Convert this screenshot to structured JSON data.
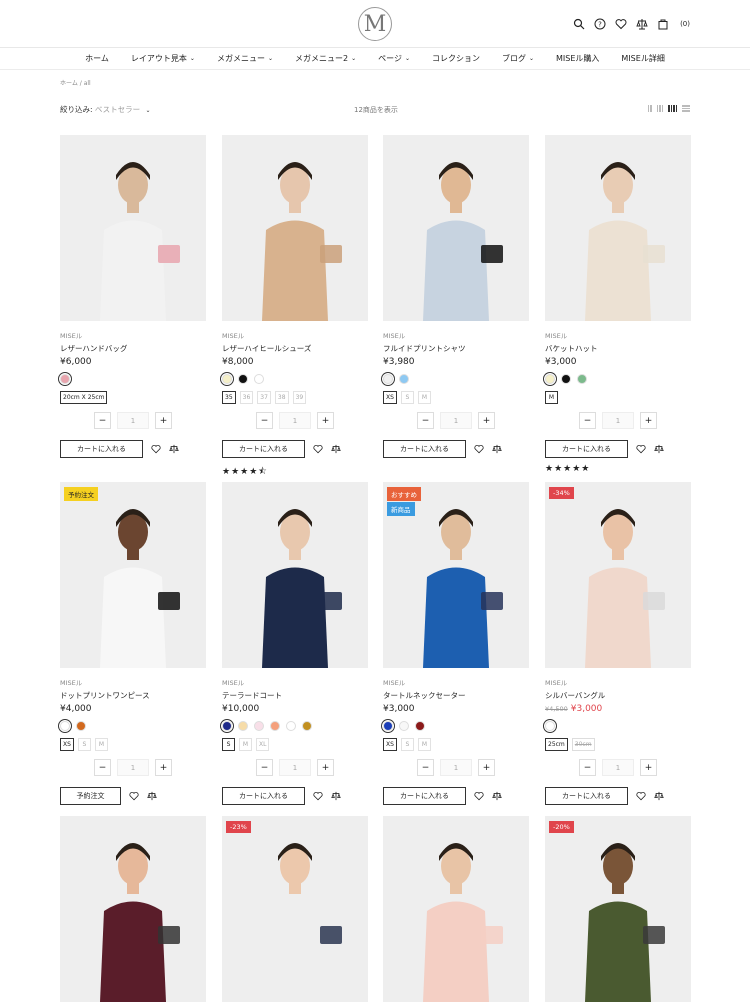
{
  "header": {
    "logo": "M",
    "cart_count": "(0)",
    "icons": [
      "search-icon",
      "help-icon",
      "heart-icon",
      "compare-icon",
      "bag-icon"
    ]
  },
  "nav": [
    {
      "label": "ホーム",
      "dropdown": false
    },
    {
      "label": "レイアウト見本",
      "dropdown": true
    },
    {
      "label": "メガメニュー",
      "dropdown": true
    },
    {
      "label": "メガメニュー2",
      "dropdown": true
    },
    {
      "label": "ページ",
      "dropdown": true
    },
    {
      "label": "コレクション",
      "dropdown": false
    },
    {
      "label": "ブログ",
      "dropdown": true
    },
    {
      "label": "MISEル購入",
      "dropdown": false
    },
    {
      "label": "MISEル詳細",
      "dropdown": false
    }
  ],
  "breadcrumb": {
    "home": "ホーム",
    "sep": "/",
    "current": "all"
  },
  "toolbar": {
    "filter_label": "絞り込み:",
    "filter_value": "ベストセラー",
    "count": "12商品を表示"
  },
  "products": [
    {
      "vendor": "MISEル",
      "title": "レザーハンドバッグ",
      "price": "¥6,000",
      "swatches": [
        "#e8a5ae"
      ],
      "sizes": [
        "20cm X 25cm"
      ],
      "qty": "1",
      "btn": "カートに入れる"
    },
    {
      "vendor": "MISEル",
      "title": "レザーハイヒールシューズ",
      "price": "¥8,000",
      "swatches": [
        "#f5f0c9",
        "#111111",
        "#ffffff"
      ],
      "sizes": [
        "35",
        "36",
        "37",
        "38",
        "39"
      ],
      "qty": "1",
      "btn": "カートに入れる",
      "stars": "★★★★⯪"
    },
    {
      "vendor": "MISEル",
      "title": "フルイドプリントシャツ",
      "price": "¥3,980",
      "swatches": [
        "#f1f1f1",
        "#8ec9f2"
      ],
      "sizes": [
        "XS",
        "S",
        "M"
      ],
      "qty": "1",
      "btn": "カートに入れる"
    },
    {
      "vendor": "MISEル",
      "title": "バケットハット",
      "price": "¥3,000",
      "swatches": [
        "#f5f0c9",
        "#111111",
        "#7cba8c"
      ],
      "sizes": [
        "M"
      ],
      "qty": "1",
      "btn": "カートに入れる",
      "stars": "★★★★★"
    },
    {
      "vendor": "MISEル",
      "title": "ドットプリントワンピース",
      "price": "¥4,000",
      "swatches": [
        "#ffffff",
        "#d2691e"
      ],
      "sizes": [
        "XS",
        "S",
        "M"
      ],
      "qty": "1",
      "btn": "予約注文",
      "badge": "予約注文"
    },
    {
      "vendor": "MISEル",
      "title": "テーラードコート",
      "price": "¥10,000",
      "swatches": [
        "#1f2a8a",
        "#f6dca8",
        "#f8dfe8",
        "#f4a07c",
        "#ffffff",
        "#c29020"
      ],
      "sizes": [
        "S",
        "M",
        "XL"
      ],
      "qty": "1",
      "btn": "カートに入れる"
    },
    {
      "vendor": "MISEル",
      "title": "タートルネックセーター",
      "price": "¥3,000",
      "swatches": [
        "#1c3fb8",
        "#f8f8f8",
        "#8b1a1a"
      ],
      "sizes": [
        "XS",
        "S",
        "M"
      ],
      "qty": "1",
      "btn": "カートに入れる",
      "badges": [
        "おすすめ",
        "新商品"
      ]
    },
    {
      "vendor": "MISEル",
      "title": "シルバーバングル",
      "old_price": "¥4,500",
      "price": "¥3,000",
      "swatches": [
        "#ffffff"
      ],
      "sizes": [
        "25cm",
        "30cm"
      ],
      "qty": "1",
      "btn": "カートに入れる",
      "badge": "-34%"
    },
    {
      "badge": ""
    },
    {
      "badge": "-23%"
    },
    {
      "badge": ""
    },
    {
      "badge": "-20%"
    }
  ]
}
